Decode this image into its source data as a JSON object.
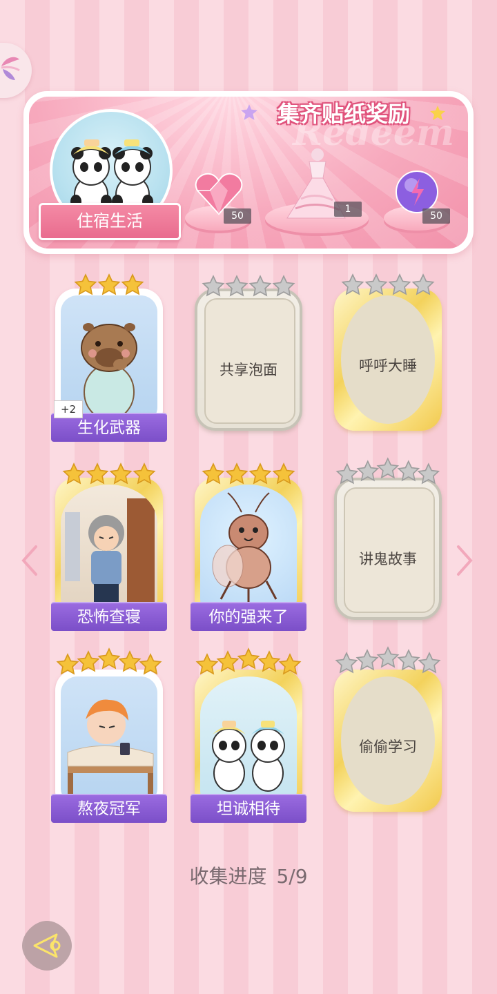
{
  "banner": {
    "title": "集齐贴纸奖励",
    "watermark": "Redeem",
    "theme_label": "住宿生活",
    "rewards": [
      {
        "icon": "pink-heart-gem-icon",
        "count": "50"
      },
      {
        "icon": "princess-dress-icon",
        "count": "1"
      },
      {
        "icon": "purple-energy-orb-icon",
        "count": "50"
      }
    ]
  },
  "cards": [
    {
      "name": "生化武器",
      "state": "collected",
      "stars": 3,
      "filled": 3,
      "extra": "+2"
    },
    {
      "name": "共享泡面",
      "state": "locked-silver",
      "stars": 4,
      "filled": 0
    },
    {
      "name": "呼呼大睡",
      "state": "locked-gold",
      "stars": 4,
      "filled": 0
    },
    {
      "name": "恐怖查寝",
      "state": "collected-gold",
      "stars": 4,
      "filled": 4
    },
    {
      "name": "你的强来了",
      "state": "collected-gold",
      "stars": 4,
      "filled": 4
    },
    {
      "name": "讲鬼故事",
      "state": "locked-silver",
      "stars": 5,
      "filled": 0
    },
    {
      "name": "熬夜冠军",
      "state": "collected",
      "stars": 5,
      "filled": 5
    },
    {
      "name": "坦诚相待",
      "state": "collected-gold",
      "stars": 5,
      "filled": 5
    },
    {
      "name": "偷偷学习",
      "state": "locked-gold",
      "stars": 5,
      "filled": 0
    }
  ],
  "progress": {
    "label": "收集进度",
    "value": "5/9"
  },
  "colors": {
    "gold_star": "#f5c23a",
    "silver_star": "#c9c9c9",
    "ribbon": "#8a5cd6",
    "banner_pink": "#f291aa"
  }
}
